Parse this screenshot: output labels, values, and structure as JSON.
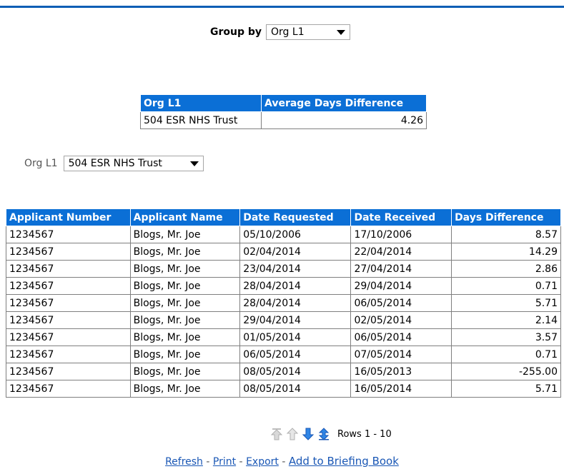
{
  "group_by": {
    "label": "Group by",
    "value": "Org L1"
  },
  "summary": {
    "headers": [
      "Org L1",
      "Average Days Difference"
    ],
    "rows": [
      {
        "org": "504 ESR NHS Trust",
        "avg": "4.26"
      }
    ]
  },
  "filter": {
    "label": "Org L1",
    "value": "504 ESR NHS Trust"
  },
  "detail": {
    "headers": [
      "Applicant Number",
      "Applicant Name",
      "Date Requested",
      "Date Received",
      "Days Difference"
    ],
    "rows": [
      [
        "1234567",
        "Blogs, Mr. Joe",
        "05/10/2006",
        "17/10/2006",
        "8.57"
      ],
      [
        "1234567",
        "Blogs, Mr. Joe",
        "02/04/2014",
        "22/04/2014",
        "14.29"
      ],
      [
        "1234567",
        "Blogs, Mr. Joe",
        "23/04/2014",
        "27/04/2014",
        "2.86"
      ],
      [
        "1234567",
        "Blogs, Mr. Joe",
        "28/04/2014",
        "29/04/2014",
        "0.71"
      ],
      [
        "1234567",
        "Blogs, Mr. Joe",
        "28/04/2014",
        "06/05/2014",
        "5.71"
      ],
      [
        "1234567",
        "Blogs, Mr. Joe",
        "29/04/2014",
        "02/05/2014",
        "2.14"
      ],
      [
        "1234567",
        "Blogs, Mr. Joe",
        "01/05/2014",
        "06/05/2014",
        "3.57"
      ],
      [
        "1234567",
        "Blogs, Mr. Joe",
        "06/05/2014",
        "07/05/2014",
        "0.71"
      ],
      [
        "1234567",
        "Blogs, Mr. Joe",
        "08/05/2014",
        "16/05/2013",
        "-255.00"
      ],
      [
        "1234567",
        "Blogs, Mr. Joe",
        "08/05/2014",
        "16/05/2014",
        "5.71"
      ]
    ]
  },
  "pager": {
    "rows_text": "Rows 1 - 10"
  },
  "links": {
    "refresh": "Refresh",
    "print": "Print",
    "export": "Export",
    "briefing": "Add to Briefing Book",
    "separator": " - "
  },
  "colors": {
    "header_blue": "#0b6fd6",
    "accent_blue": "#0b5eb5",
    "link_blue": "#1a57b5"
  },
  "icons": [
    "first-page-icon",
    "prev-page-icon",
    "next-page-icon",
    "all-pages-icon"
  ]
}
